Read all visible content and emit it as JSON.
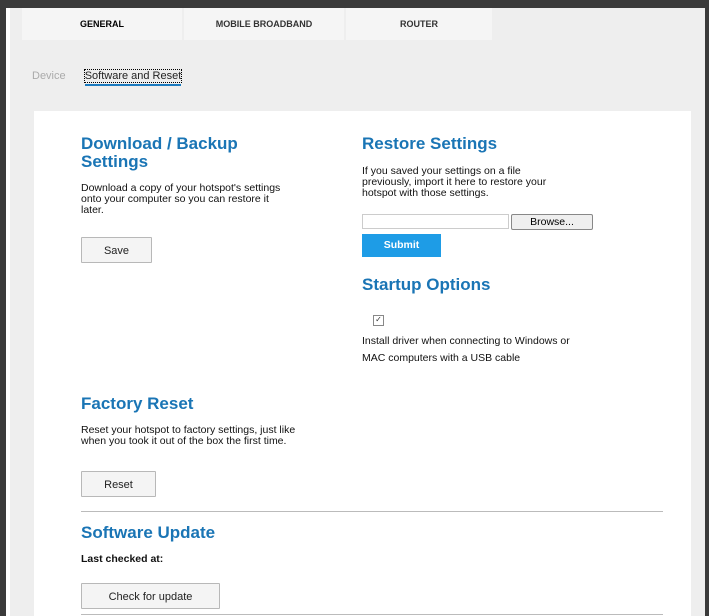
{
  "tabs": [
    {
      "label": "GENERAL"
    },
    {
      "label": "MOBILE BROADBAND"
    },
    {
      "label": "ROUTER"
    }
  ],
  "breadcrumb": {
    "device": "Device",
    "current": "Software and Reset"
  },
  "download_backup": {
    "title_line1": "Download / Backup",
    "title_line2": "Settings",
    "desc_line1": "Download a copy of your hotspot's settings",
    "desc_line2": "onto your computer so you can restore it",
    "desc_line3": "later.",
    "save_label": "Save"
  },
  "restore": {
    "title": "Restore Settings",
    "desc_line1": "If you saved your settings on a file",
    "desc_line2": "previously, import it here to restore your",
    "desc_line3": "hotspot with those settings.",
    "browse_label": "Browse...",
    "submit_label": "Submit"
  },
  "startup": {
    "title": "Startup Options",
    "checkbox_mark": "✓",
    "checked": true,
    "label_line1": "Install driver when connecting to Windows or",
    "label_line2": "MAC computers with a USB cable"
  },
  "factory_reset": {
    "title": "Factory Reset",
    "desc_line1": "Reset your hotspot to factory settings, just like",
    "desc_line2": "when you took it out of the box the first time.",
    "reset_label": "Reset"
  },
  "software_update": {
    "title": "Software Update",
    "last_checked": "Last checked at:",
    "check_label": "Check for update"
  },
  "colors": {
    "heading": "#1a75b5",
    "submit_bg": "#1e9ce6",
    "page_bg": "#eeeeee"
  }
}
